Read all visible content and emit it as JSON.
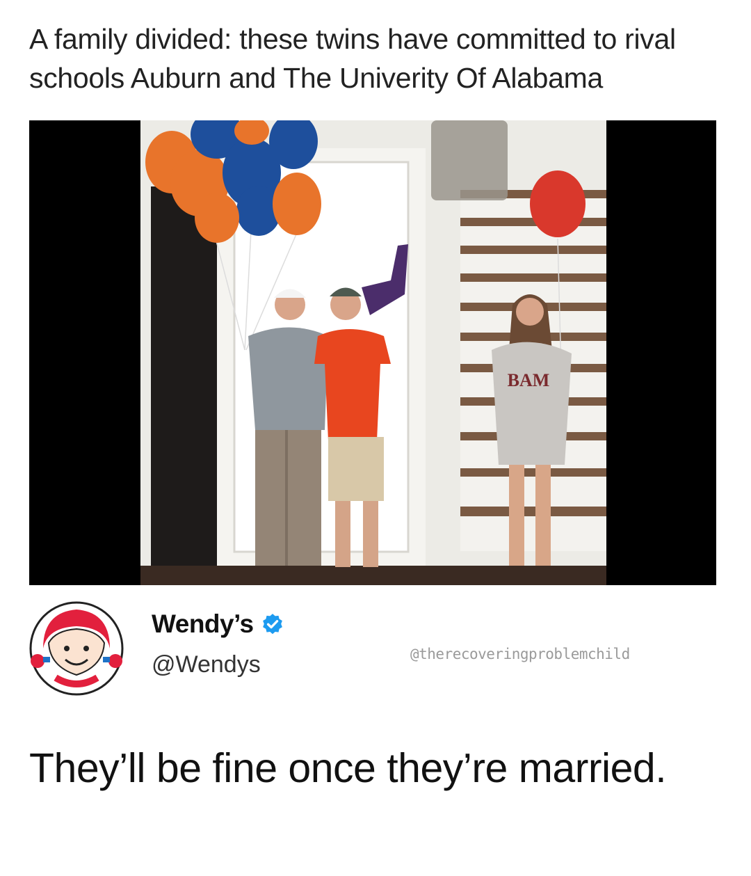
{
  "post": {
    "caption": "A family divided: these twins have committed to rival schools Auburn and The Univerity Of Alabama"
  },
  "photo": {
    "shirt_text": "BAM",
    "balloon_colors": [
      "#e8742b",
      "#1e4f9c",
      "#d9382c"
    ]
  },
  "tweet": {
    "account_name": "Wendy’s",
    "handle": "@Wendys",
    "watermark": "@therecoveringproblemchild",
    "text": "They’ll be fine once they’re married.",
    "verified_color": "#1d9bf0",
    "brand_color": "#e2203d"
  }
}
